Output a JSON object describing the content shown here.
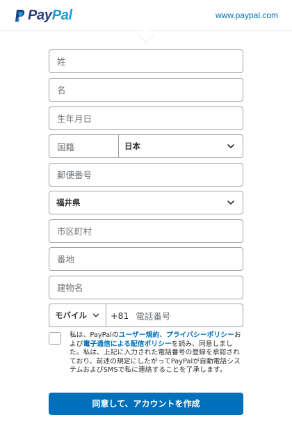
{
  "header": {
    "logo_text_pay": "Pay",
    "logo_text_pal": "Pal",
    "site_link": "www.paypal.com",
    "brand_colors": {
      "dark": "#253b80",
      "light": "#179bd7",
      "link": "#0070ba"
    }
  },
  "form": {
    "last_name_placeholder": "姓",
    "first_name_placeholder": "名",
    "birthdate_placeholder": "生年月日",
    "nationality_label": "国籍",
    "nationality_value": "日本",
    "postal_code_placeholder": "郵便番号",
    "prefecture_value": "福井県",
    "city_placeholder": "市区町村",
    "address_placeholder": "番地",
    "building_placeholder": "建物名",
    "phone_type": "モバイル",
    "phone_country_code": "+81",
    "phone_number_placeholder": "電話番号"
  },
  "consent": {
    "text_1": "私は、PayPalの",
    "link_user_agreement": "ユーザー規約",
    "text_2": "、",
    "link_privacy_policy": "プライバシーポリシー",
    "text_3": "および",
    "link_ecomm_policy": "電子通信による配信ポリシー",
    "text_4": "を読み、同意しました。私は、上記に入力された電話番号の登録を承認されており、前述の規定にしたがってPayPalが自動電話システムおよびSMSで私に連絡することを了承します。"
  },
  "submit_label": "同意して、アカウントを作成",
  "icons": {
    "logo": "paypal-logo-icon",
    "dropdown": "chevron-down-icon"
  }
}
